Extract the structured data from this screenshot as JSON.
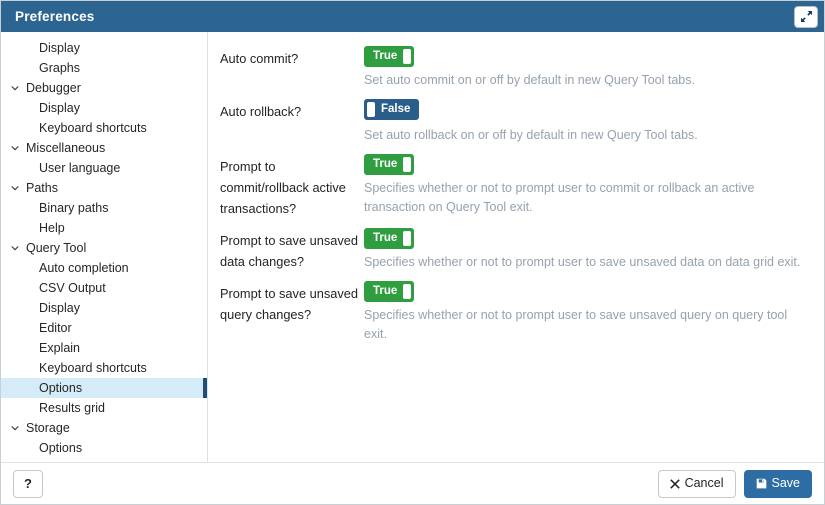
{
  "window": {
    "title": "Preferences",
    "maximize_icon": "maximize-icon"
  },
  "sidebar": {
    "items": [
      {
        "label": "Display",
        "level": 1,
        "expandable": false,
        "selected": false
      },
      {
        "label": "Graphs",
        "level": 1,
        "expandable": false,
        "selected": false
      },
      {
        "label": "Debugger",
        "level": 0,
        "expandable": true,
        "selected": false
      },
      {
        "label": "Display",
        "level": 1,
        "expandable": false,
        "selected": false
      },
      {
        "label": "Keyboard shortcuts",
        "level": 1,
        "expandable": false,
        "selected": false
      },
      {
        "label": "Miscellaneous",
        "level": 0,
        "expandable": true,
        "selected": false
      },
      {
        "label": "User language",
        "level": 1,
        "expandable": false,
        "selected": false
      },
      {
        "label": "Paths",
        "level": 0,
        "expandable": true,
        "selected": false
      },
      {
        "label": "Binary paths",
        "level": 1,
        "expandable": false,
        "selected": false
      },
      {
        "label": "Help",
        "level": 1,
        "expandable": false,
        "selected": false
      },
      {
        "label": "Query Tool",
        "level": 0,
        "expandable": true,
        "selected": false
      },
      {
        "label": "Auto completion",
        "level": 1,
        "expandable": false,
        "selected": false
      },
      {
        "label": "CSV Output",
        "level": 1,
        "expandable": false,
        "selected": false
      },
      {
        "label": "Display",
        "level": 1,
        "expandable": false,
        "selected": false
      },
      {
        "label": "Editor",
        "level": 1,
        "expandable": false,
        "selected": false
      },
      {
        "label": "Explain",
        "level": 1,
        "expandable": false,
        "selected": false
      },
      {
        "label": "Keyboard shortcuts",
        "level": 1,
        "expandable": false,
        "selected": false
      },
      {
        "label": "Options",
        "level": 1,
        "expandable": false,
        "selected": true
      },
      {
        "label": "Results grid",
        "level": 1,
        "expandable": false,
        "selected": false
      },
      {
        "label": "Storage",
        "level": 0,
        "expandable": true,
        "selected": false
      },
      {
        "label": "Options",
        "level": 1,
        "expandable": false,
        "selected": false
      }
    ]
  },
  "content": {
    "settings": [
      {
        "label": "Auto commit?",
        "value": "True",
        "state": "on",
        "help": "Set auto commit on or off by default in new Query Tool tabs."
      },
      {
        "label": "Auto rollback?",
        "value": "False",
        "state": "off",
        "help": "Set auto rollback on or off by default in new Query Tool tabs."
      },
      {
        "label": "Prompt to commit/rollback active transactions?",
        "value": "True",
        "state": "on",
        "help": "Specifies whether or not to prompt user to commit or rollback an active transaction on Query Tool exit."
      },
      {
        "label": "Prompt to save unsaved data changes?",
        "value": "True",
        "state": "on",
        "help": "Specifies whether or not to prompt user to save unsaved data on data grid exit."
      },
      {
        "label": "Prompt to save unsaved query changes?",
        "value": "True",
        "state": "on",
        "help": "Specifies whether or not to prompt user to save unsaved query on query tool exit."
      }
    ]
  },
  "footer": {
    "help_label": "?",
    "cancel_label": "Cancel",
    "save_label": "Save"
  },
  "colors": {
    "titlebar": "#2c6492",
    "toggle_on": "#2f9e41",
    "toggle_off": "#2b5d8b",
    "save_button": "#2e6da4",
    "selected_row": "#d5ebf8",
    "selected_indicator": "#1d4f73",
    "help_text": "#96a2ae"
  }
}
